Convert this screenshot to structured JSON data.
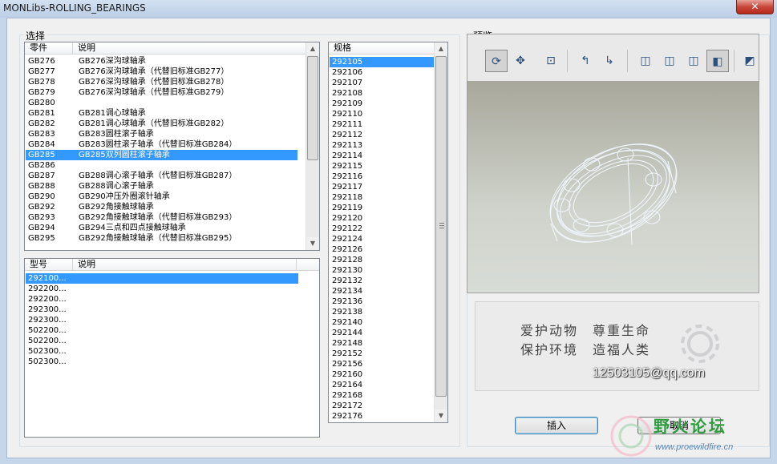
{
  "window": {
    "title": "MONLibs-ROLLING_BEARINGS",
    "close_glyph": "✕"
  },
  "select_group": {
    "label": "选择"
  },
  "parts_list": {
    "headers": [
      "零件",
      "说明"
    ],
    "selected_index": 9,
    "rows": [
      [
        "GB276",
        "GB276深沟球轴承"
      ],
      [
        "GB277",
        "GB276深沟球轴承（代替旧标准GB277）"
      ],
      [
        "GB278",
        "GB276深沟球轴承（代替旧标准GB278）"
      ],
      [
        "GB279",
        "GB276深沟球轴承（代替旧标准GB279）"
      ],
      [
        "GB280",
        ""
      ],
      [
        "GB281",
        "GB281调心球轴承"
      ],
      [
        "GB282",
        "GB281调心球轴承（代替旧标准GB282）"
      ],
      [
        "GB283",
        "GB283圆柱滚子轴承"
      ],
      [
        "GB284",
        "GB283圆柱滚子轴承（代替旧标准GB284）"
      ],
      [
        "GB285",
        "GB285双列圆柱滚子轴承"
      ],
      [
        "GB286",
        ""
      ],
      [
        "GB287",
        "GB288调心滚子轴承（代替旧标准GB287）"
      ],
      [
        "GB288",
        "GB288调心滚子轴承"
      ],
      [
        "GB290",
        "GB290冲压外圈滚针轴承"
      ],
      [
        "GB292",
        "GB292角接触球轴承"
      ],
      [
        "GB293",
        "GB292角接触球轴承（代替旧标准GB293）"
      ],
      [
        "GB294",
        "GB294三点和四点接触球轴承"
      ],
      [
        "GB295",
        "GB292角接触球轴承（代替旧标准GB295）"
      ]
    ]
  },
  "model_list": {
    "headers": [
      "型号",
      "说明"
    ],
    "selected_index": 0,
    "rows": [
      "292100...",
      "292200...",
      "292200...",
      "292300...",
      "292300...",
      "502200...",
      "502200...",
      "502300...",
      "502300..."
    ]
  },
  "spec_list": {
    "header": "规格",
    "selected_index": 0,
    "rows": [
      "292105",
      "292106",
      "292107",
      "292108",
      "292109",
      "292110",
      "292111",
      "292112",
      "292113",
      "292114",
      "292115",
      "292116",
      "292117",
      "292118",
      "292119",
      "292120",
      "292122",
      "292124",
      "292126",
      "292128",
      "292130",
      "292132",
      "292134",
      "292136",
      "292138",
      "292140",
      "292144",
      "292148",
      "292152",
      "292156",
      "292160",
      "292164",
      "292168",
      "292172",
      "292176"
    ]
  },
  "preview_group": {
    "label": "预览"
  },
  "toolbar": {
    "buttons": [
      {
        "name": "spin-center-icon",
        "glyph": "⟳",
        "pressed": true
      },
      {
        "name": "pan-icon",
        "glyph": "✥",
        "pressed": false
      },
      {
        "name": "zoom-window-icon",
        "glyph": "⊡",
        "pressed": false
      },
      {
        "name": "zoom-in-icon",
        "glyph": "↰",
        "pressed": false
      },
      {
        "name": "zoom-out-icon",
        "glyph": "↳",
        "pressed": false
      },
      {
        "name": "wireframe-icon",
        "glyph": "◫",
        "pressed": false
      },
      {
        "name": "hidden-line-icon",
        "glyph": "◫",
        "pressed": false
      },
      {
        "name": "no-hidden-icon",
        "glyph": "◫",
        "pressed": false
      },
      {
        "name": "shading-icon",
        "glyph": "◧",
        "pressed": true
      },
      {
        "name": "view-orient-icon",
        "glyph": "◩",
        "pressed": false
      }
    ]
  },
  "slogan": {
    "line1": "爱护动物　尊重生命",
    "line2": "保护环境　造福人类",
    "email": "12503105@qq.com"
  },
  "buttons": {
    "insert": "插入",
    "cancel": "取消"
  },
  "watermark": {
    "text": "野火论坛",
    "url": "www.proewildfire.cn"
  }
}
